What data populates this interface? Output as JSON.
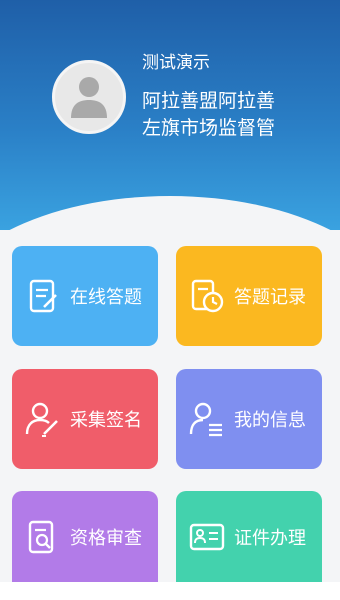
{
  "profile": {
    "name": "测试演示",
    "organization": "阿拉善盟阿拉善左旗市场监督管",
    "avatar_icon": "user-avatar-icon"
  },
  "tiles": [
    {
      "label": "在线答题",
      "icon": "document-edit-icon",
      "color": "#4db1f3"
    },
    {
      "label": "答题记录",
      "icon": "clock-record-icon",
      "color": "#fbb820"
    },
    {
      "label": "采集签名",
      "icon": "user-signature-icon",
      "color": "#f05d6a"
    },
    {
      "label": "我的信息",
      "icon": "user-info-icon",
      "color": "#7f8ff0"
    },
    {
      "label": "资格审查",
      "icon": "document-search-icon",
      "color": "#b27be8"
    },
    {
      "label": "证件办理",
      "icon": "id-card-icon",
      "color": "#43d2ad"
    }
  ]
}
